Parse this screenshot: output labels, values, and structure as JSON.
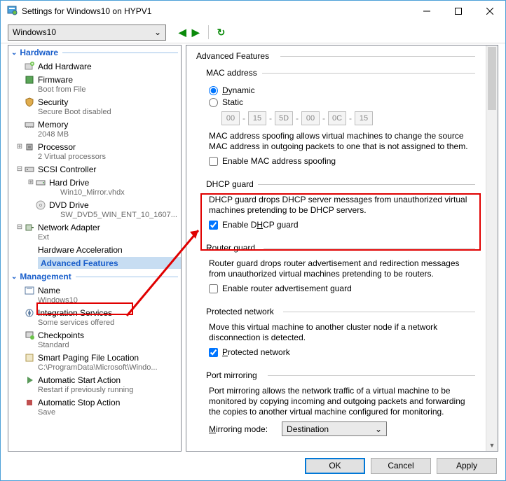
{
  "window": {
    "title": "Settings for Windows10 on HYPV1"
  },
  "toolbar": {
    "vm": "Windows10"
  },
  "tree": {
    "hardware": "Hardware",
    "management": "Management",
    "add_hw": "Add Hardware",
    "firmware": "Firmware",
    "firmware_sub": "Boot from File",
    "security": "Security",
    "security_sub": "Secure Boot disabled",
    "memory": "Memory",
    "memory_sub": "2048 MB",
    "processor": "Processor",
    "processor_sub": "2 Virtual processors",
    "scsi": "SCSI Controller",
    "hdd": "Hard Drive",
    "hdd_sub": "Win10_Mirror.vhdx",
    "dvd": "DVD Drive",
    "dvd_sub": "SW_DVD5_WIN_ENT_10_1607...",
    "net": "Network Adapter",
    "net_sub": "Ext",
    "hwaccel": "Hardware Acceleration",
    "advfeat": "Advanced Features",
    "name": "Name",
    "name_sub": "Windows10",
    "integ": "Integration Services",
    "integ_sub": "Some services offered",
    "chk": "Checkpoints",
    "chk_sub": "Standard",
    "spf": "Smart Paging File Location",
    "spf_sub": "C:\\ProgramData\\Microsoft\\Windo...",
    "astart": "Automatic Start Action",
    "astart_sub": "Restart if previously running",
    "astop": "Automatic Stop Action",
    "astop_sub": "Save"
  },
  "right": {
    "title": "Advanced Features",
    "mac": {
      "title": "MAC address",
      "dynamic": "Dynamic",
      "static": "Static",
      "cells": [
        "00",
        "15",
        "5D",
        "00",
        "0C",
        "15"
      ],
      "desc": "MAC address spoofing allows virtual machines to change the source MAC address in outgoing packets to one that is not assigned to them.",
      "cb": "Enable MAC address spoofing"
    },
    "dhcp": {
      "title": "DHCP guard",
      "desc": "DHCP guard drops DHCP server messages from unauthorized virtual machines pretending to be DHCP servers.",
      "cb": "Enable DHCP guard"
    },
    "router": {
      "title": "Router guard",
      "desc": "Router guard drops router advertisement and redirection messages from unauthorized virtual machines pretending to be routers.",
      "cb": "Enable router advertisement guard"
    },
    "pnet": {
      "title": "Protected network",
      "desc": "Move this virtual machine to another cluster node if a network disconnection is detected.",
      "cb": "Protected network"
    },
    "mirror": {
      "title": "Port mirroring",
      "desc": "Port mirroring allows the network traffic of a virtual machine to be monitored by copying incoming and outgoing packets and forwarding the copies to another virtual machine configured for monitoring.",
      "mode_label": "Mirroring mode:",
      "mode_value": "Destination"
    }
  },
  "footer": {
    "ok": "OK",
    "cancel": "Cancel",
    "apply": "Apply"
  }
}
